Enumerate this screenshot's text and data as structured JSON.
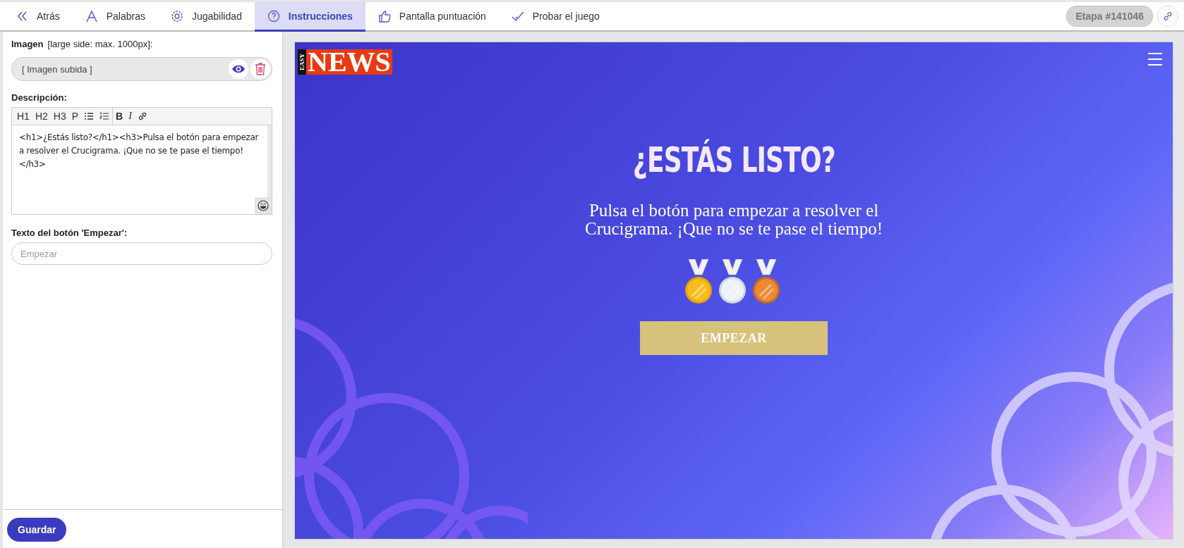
{
  "tabs": [
    {
      "kind": "back",
      "label": "Atrás",
      "selected": false
    },
    {
      "kind": "words",
      "label": "Palabras",
      "selected": false
    },
    {
      "kind": "settings",
      "label": "Jugabilidad",
      "selected": false
    },
    {
      "kind": "help",
      "label": "Instrucciones",
      "selected": true
    },
    {
      "kind": "thumbs-up",
      "label": "Pantalla puntuación",
      "selected": false
    },
    {
      "kind": "check",
      "label": "Probar el juego",
      "selected": false
    }
  ],
  "stage_badge": "Etapa #141046",
  "editor": {
    "image_label": "Imagen",
    "image_hint": "[large side: max. 1000px]:",
    "image_value": "[ Imagen subida ]",
    "description_label": "Descripción:",
    "toolbar": [
      {
        "kind": "text",
        "label": "H1"
      },
      {
        "kind": "text",
        "label": "H2"
      },
      {
        "kind": "text",
        "label": "H3"
      },
      {
        "kind": "text",
        "label": "P"
      },
      {
        "kind": "bullet-list"
      },
      {
        "kind": "numbered-list"
      },
      {
        "kind": "bold",
        "label": "B"
      },
      {
        "kind": "italic",
        "label": "I"
      },
      {
        "kind": "link"
      }
    ],
    "description_value": "<h1>¿Estás listo?</h1><h3>Pulsa el botón para empezar a resolver el Crucigrama. ¡Que no se te pase el tiempo!</h3>",
    "button_text_label": "Texto del botón 'Empezar':",
    "button_text_placeholder": "Empezar"
  },
  "save_button": "Guardar",
  "preview": {
    "logo_side": "EASY",
    "logo_main": "NEWS",
    "title": "¿ESTÁS LISTO?",
    "subtitle": "Pulsa el botón para empezar a resolver el Crucigrama. ¡Que no se te pase el tiempo!",
    "start_button": "EMPEZAR"
  }
}
